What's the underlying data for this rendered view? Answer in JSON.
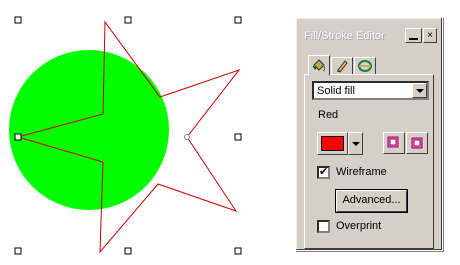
{
  "canvas": {
    "circle_fill": "#00ff00",
    "star_stroke": "#cc0000"
  },
  "docker": {
    "title": "Fill/Stroke Editor",
    "titlebar_color": "#aaaaaa",
    "close_glyph": "×",
    "tabs": [
      {
        "icon": "paint-bucket-icon",
        "active": true
      },
      {
        "icon": "pencil-icon",
        "active": false
      },
      {
        "icon": "stroke-outline-icon",
        "active": false
      }
    ],
    "fill_type": {
      "selected": "Solid fill"
    },
    "color_name": "Red",
    "color_value": "#ff0000",
    "wireframe": {
      "label": "Wireframe",
      "checked": true,
      "check_glyph": "✔"
    },
    "advanced_label": "Advanced...",
    "overprint": {
      "label": "Overprint",
      "checked": false
    }
  }
}
